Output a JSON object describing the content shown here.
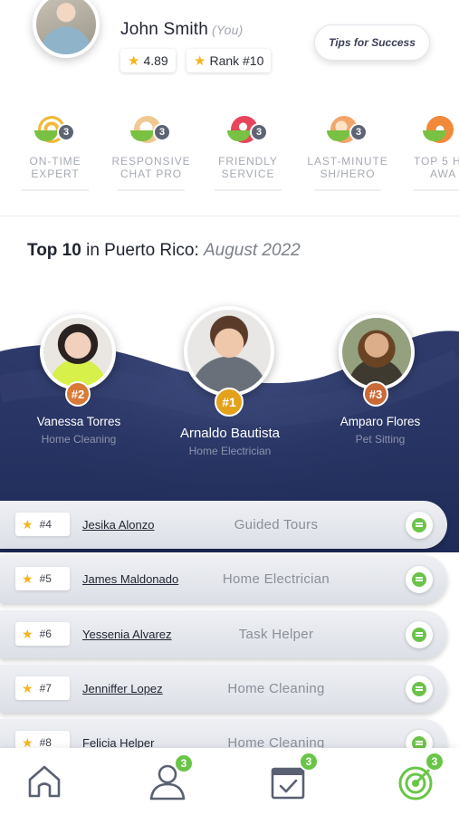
{
  "profile": {
    "name": "John Smith",
    "you_tag": "(You)",
    "rating": "4.89",
    "rank": "Rank #10",
    "tips_button": "Tips for Success"
  },
  "badges": [
    {
      "label_line1": "ON-TIME",
      "label_line2": "EXPERT",
      "count": "3",
      "icon": "target-icon",
      "color": "#f3b73a"
    },
    {
      "label_line1": "RESPONSIVE",
      "label_line2": "CHAT PRO",
      "count": "3",
      "icon": "chat-bubble-icon",
      "color": "#f0c890"
    },
    {
      "label_line1": "FRIENDLY",
      "label_line2": "SERVICE",
      "count": "3",
      "icon": "heart-like-icon",
      "color": "#e8445a"
    },
    {
      "label_line1": "LAST-MINUTE",
      "label_line2": "SH/HERO",
      "count": "3",
      "icon": "hero-icon",
      "color": "#f3a66a"
    },
    {
      "label_line1": "TOP 5 H",
      "label_line2": "AWA",
      "count": "",
      "icon": "award-icon",
      "color": "#f08a3a"
    }
  ],
  "leaderboard": {
    "title_bold": "Top 10",
    "title_region": " in Puerto Rico: ",
    "title_month": "August 2022",
    "podium": [
      {
        "rank": "#2",
        "name": "Vanessa Torres",
        "service": "Home Cleaning"
      },
      {
        "rank": "#1",
        "name": "Arnaldo Bautista",
        "service": "Home Electrician"
      },
      {
        "rank": "#3",
        "name": "Amparo Flores",
        "service": "Pet Sitting"
      }
    ],
    "rows": [
      {
        "rank": "#4",
        "name": "Jesika Alonzo",
        "service": "Guided Tours"
      },
      {
        "rank": "#5",
        "name": "James Maldonado",
        "service": "Home Electrician"
      },
      {
        "rank": "#6",
        "name": "Yessenia Alvarez",
        "service": "Task Helper"
      },
      {
        "rank": "#7",
        "name": "Jenniffer Lopez",
        "service": "Home Cleaning"
      },
      {
        "rank": "#8",
        "name": "Felicia Helper",
        "service": "Home Cleaning"
      }
    ]
  },
  "bottom_nav": [
    {
      "icon": "home-icon",
      "badge": ""
    },
    {
      "icon": "profile-icon",
      "badge": "3"
    },
    {
      "icon": "calendar-check-icon",
      "badge": "3"
    },
    {
      "icon": "target-active-icon",
      "badge": "3"
    }
  ],
  "colors": {
    "navy": "#23305d",
    "accent_green": "#69c548",
    "star": "#f5b51c",
    "rank_gold": "#e4a21b",
    "rank_bronze": "#d97a36"
  }
}
